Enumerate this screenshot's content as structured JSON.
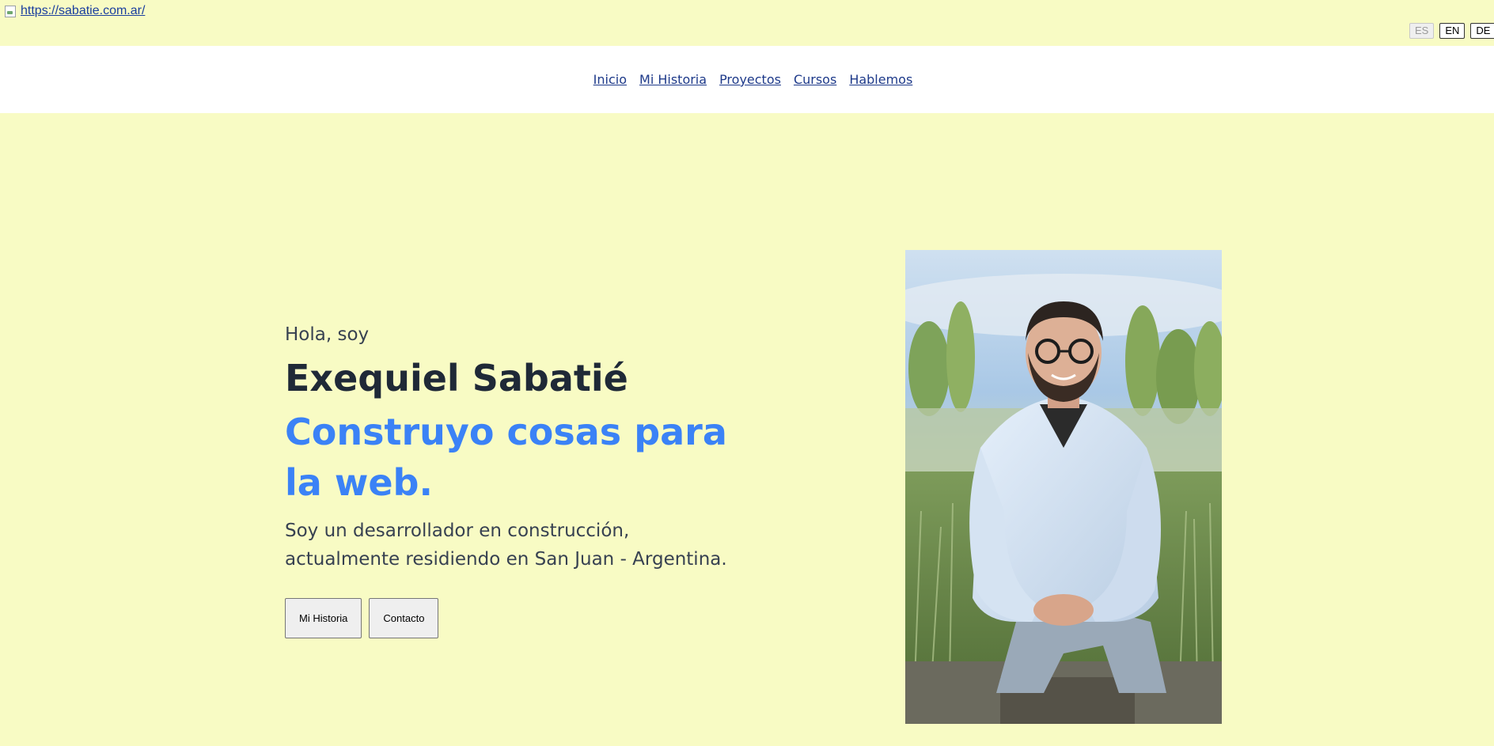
{
  "header": {
    "logo_link_text": "https://sabatie.com.ar/",
    "languages": [
      "ES",
      "EN",
      "DE"
    ]
  },
  "nav": {
    "items": [
      "Inicio",
      "Mi Historia",
      "Proyectos",
      "Cursos",
      "Hablemos"
    ]
  },
  "hero": {
    "greeting": "Hola, soy",
    "name": "Exequiel Sabatié",
    "tagline": "Construyo cosas para la web.",
    "description": "Soy un desarrollador en construcción, actualmente residiendo en San Juan - Argentina.",
    "buttons": [
      "Mi Historia",
      "Contacto"
    ]
  },
  "colors": {
    "background": "#f8fbc4",
    "navbar": "#ffffff",
    "accent": "#3b82f6",
    "heading": "#1f2937"
  },
  "icons": {
    "broken_image": "broken-image-icon"
  }
}
